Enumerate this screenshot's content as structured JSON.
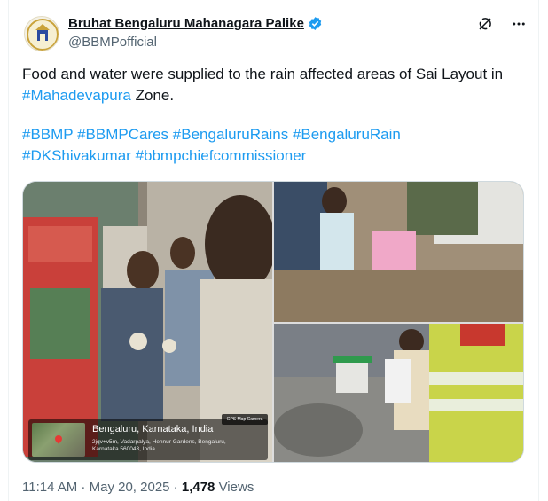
{
  "account": {
    "display_name": "Bruhat Bengaluru Mahanagara Palike",
    "handle": "@BBMPofficial",
    "verified": true
  },
  "tweet": {
    "text_line": "Food and water were supplied to the rain affected areas of Sai Layout in",
    "mention_tag": "#Mahadevapura",
    "text_end": " Zone.",
    "hashtags_line1": [
      "#BBMP",
      "#BBMPCares",
      "#BengaluruRains",
      "#BengaluruRain"
    ],
    "hashtags_line2": [
      "#DKShivakumar",
      "#bbmpchiefcommissioner"
    ]
  },
  "media": {
    "geo_badge": "GPS Map Camera",
    "geo_city": "Bengaluru, Karnataka, India",
    "geo_address_1": "2jqv+v5m, Vadarpalya, Hennur Gardens, Bengaluru,",
    "geo_address_2": "Karnataka 560043, India"
  },
  "meta": {
    "time": "11:14 AM",
    "sep1": " · ",
    "date": "May 20, 2025",
    "sep2": " · ",
    "views_count": "1,478",
    "views_label": " Views"
  },
  "icons": [
    "grok-icon",
    "more-options-icon",
    "verified-badge-icon",
    "map-pin-icon"
  ],
  "colors": {
    "link": "#1d9bf0",
    "verified": "#1d9bf0",
    "muted": "#536471",
    "text": "#0f1419"
  }
}
